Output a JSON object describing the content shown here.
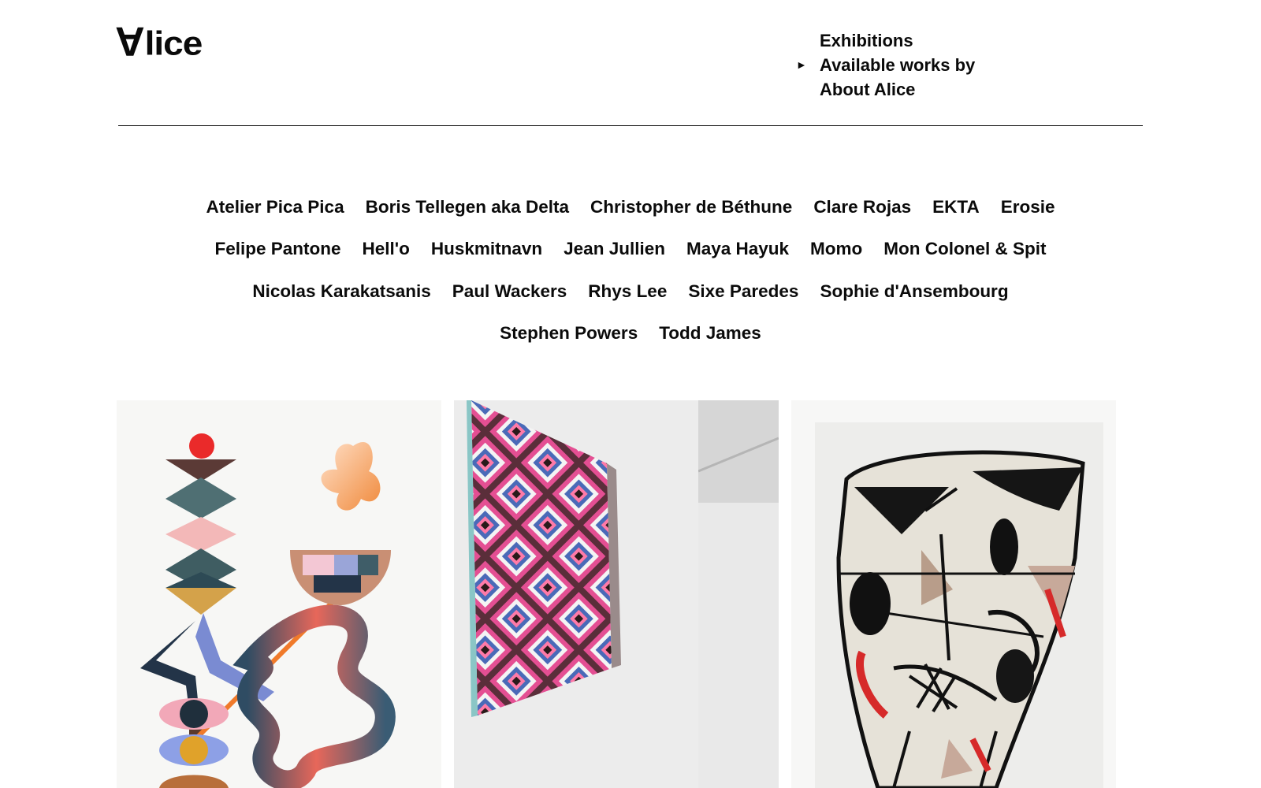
{
  "brand": {
    "logo_first": "A",
    "logo_rest": "lice"
  },
  "nav": {
    "items": [
      {
        "label": "Exhibitions",
        "active": false
      },
      {
        "label": "Available works by",
        "active": true
      },
      {
        "label": "About Alice",
        "active": false
      }
    ],
    "active_marker": "►"
  },
  "artists": [
    [
      "Atelier Pica Pica",
      "Boris Tellegen aka Delta",
      "Christopher de Béthune",
      "Clare Rojas",
      "EKTA",
      "Erosie"
    ],
    [
      "Felipe Pantone",
      "Hell'o",
      "Huskmitnavn",
      "Jean Jullien",
      "Maya Hayuk",
      "Momo",
      "Mon Colonel & Spit"
    ],
    [
      "Nicolas Karakatsanis",
      "Paul Wackers",
      "Rhys Lee",
      "Sixe Paredes",
      "Sophie d'Ansembourg"
    ],
    [
      "Stephen Powers",
      "Todd James"
    ]
  ],
  "artworks": [
    {
      "type": "totem-collage",
      "bg": "#f7f7f5"
    },
    {
      "type": "diamond-pattern-canvas",
      "bg": "#e6e6e6"
    },
    {
      "type": "abstract-face-drawing",
      "bg": "#f1f1ef"
    }
  ]
}
